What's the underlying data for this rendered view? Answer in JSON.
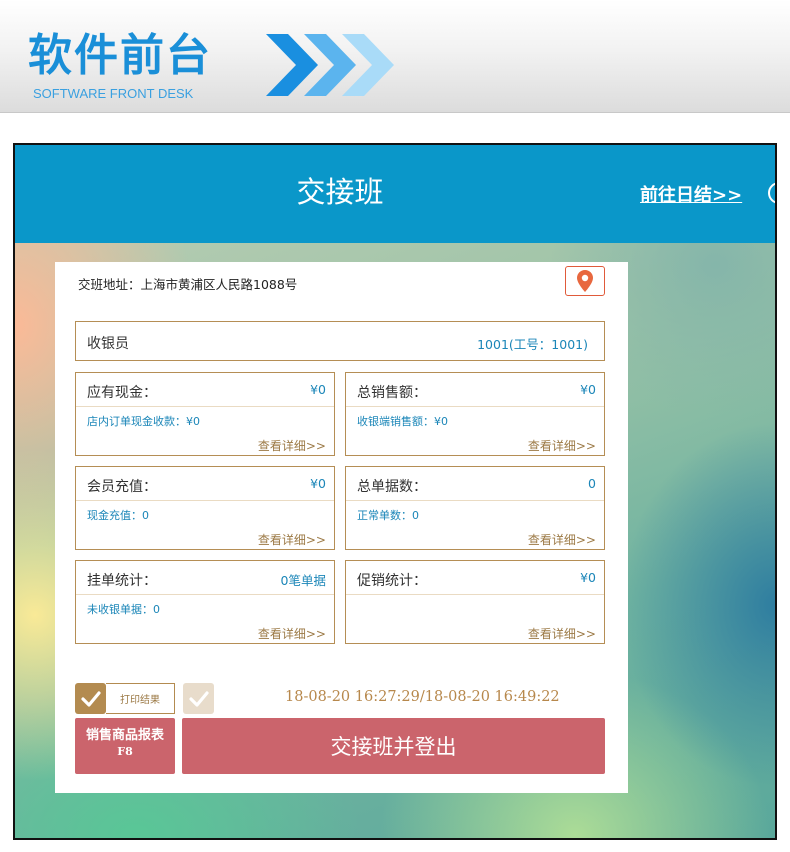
{
  "banner": {
    "title": "软件前台",
    "subtitle": "SOFTWARE FRONT DESK",
    "title_color": "#1a8fd8",
    "arrow_icon": "triple-chevron-right-icon"
  },
  "app": {
    "title": "交接班",
    "goto_daily_link": "前往日结>>",
    "header_color": "#0a97c9",
    "address": "交班地址：上海市黄浦区人民路1088号",
    "location_icon": "map-pin-icon",
    "cashier": {
      "label": "收银员",
      "value": "1001(工号：1001)"
    },
    "cards": [
      {
        "label": "应有现金：",
        "value": "¥0",
        "sub": "店内订单现金收款：¥0",
        "detail": "查看详细>>"
      },
      {
        "label": "总销售额：",
        "value": "¥0",
        "sub": "收银端销售额：¥0",
        "detail": "查看详细>>"
      },
      {
        "label": "会员充值：",
        "value": "¥0",
        "sub": "现金充值：0",
        "detail": "查看详细>>"
      },
      {
        "label": "总单据数：",
        "value": "0",
        "sub": "正常单数：0",
        "detail": "查看详细>>"
      },
      {
        "label": "挂单统计：",
        "value": "0笔单据",
        "sub": "未收银单据：0",
        "detail": "查看详细>>"
      },
      {
        "label": "促销统计：",
        "value": "¥0",
        "sub": "",
        "detail": "查看详细>>"
      }
    ],
    "print_result_label": "打印结果",
    "print_checked": true,
    "time_range": "18-08-20 16:27:29/18-08-20 16:49:22",
    "report_button": {
      "label": "销售商品报表",
      "key": "F8"
    },
    "logout_button": "交接班并登出",
    "button_color": "#cb646c",
    "accent_gold": "#b58e55"
  }
}
